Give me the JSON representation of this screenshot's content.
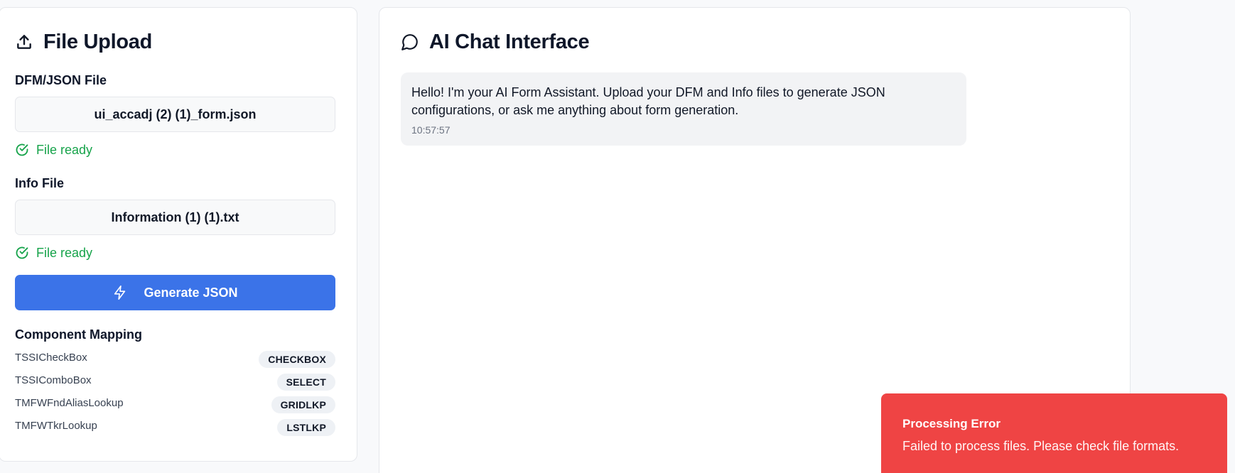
{
  "upload": {
    "title": "File Upload",
    "dfm_label": "DFM/JSON File",
    "dfm_file": "ui_accadj (2) (1)_form.json",
    "dfm_status": "File ready",
    "info_label": "Info File",
    "info_file": "Information (1) (1).txt",
    "info_status": "File ready",
    "generate_label": "Generate JSON",
    "mapping_title": "Component Mapping",
    "mappings": [
      {
        "name": "TSSICheckBox",
        "type": "CHECKBOX"
      },
      {
        "name": "TSSIComboBox",
        "type": "SELECT"
      },
      {
        "name": "TMFWFndAliasLookup",
        "type": "GRIDLKP"
      },
      {
        "name": "TMFWTkrLookup",
        "type": "LSTLKP"
      }
    ]
  },
  "chat": {
    "title": "AI Chat Interface",
    "messages": [
      {
        "text": "Hello! I'm your AI Form Assistant. Upload your DFM and Info files to generate JSON configurations, or ask me anything about form generation.",
        "time": "10:57:57"
      }
    ]
  },
  "toast": {
    "title": "Processing Error",
    "message": "Failed to process files. Please check file formats."
  },
  "icons": {
    "upload": "upload-icon",
    "check": "check-circle-icon",
    "bolt": "lightning-icon",
    "chat": "message-circle-icon"
  },
  "colors": {
    "primary": "#3b73e8",
    "success": "#16a34a",
    "error": "#ef4444"
  }
}
